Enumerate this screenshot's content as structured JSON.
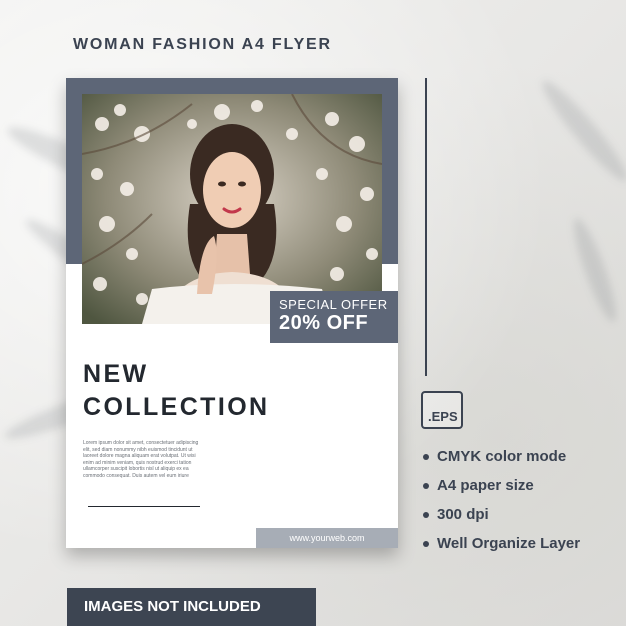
{
  "header": {
    "title": "WOMAN FASHION A4 FLYER"
  },
  "flyer": {
    "offer_top": "SPECIAL OFFER",
    "offer_main": "20% OFF",
    "headline_1": "NEW",
    "headline_2": "COLLECTION",
    "body_text": "Lorem ipsum dolor sit amet, consectetuer adipiscing elit, sed diam nonummy nibh euismod tincidunt ut laoreet dolore magna aliquam erat volutpat. Ut wisi enim ad minim veniam, quis nostrud exerci tation ullamcorper suscipit lobortis nisl ut aliquip ex ea commodo consequat. Duis autem vel eum iriure",
    "website": "www.yourweb.com"
  },
  "specs": {
    "format_label": ".EPS",
    "items": [
      "CMYK color mode",
      "A4 paper size",
      "300 dpi",
      "Well Organize Layer"
    ]
  },
  "footer": {
    "notice": "IMAGES NOT INCLUDED"
  },
  "colors": {
    "navy": "#3b4351",
    "slate": "#5d6677",
    "web_bar": "#a7adb6"
  }
}
